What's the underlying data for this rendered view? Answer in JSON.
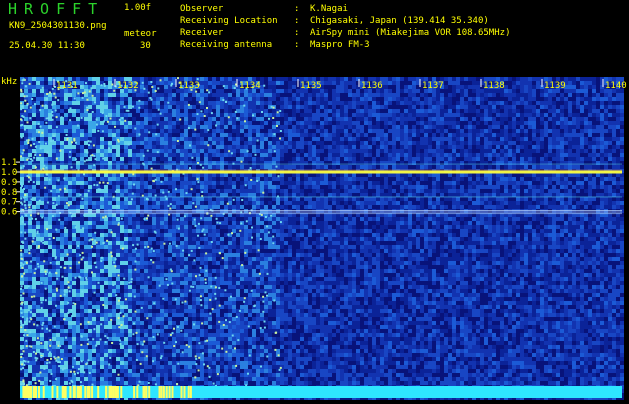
{
  "header": {
    "title": "HROFFT",
    "version": "1.00f",
    "file_name": "KN9_2504301130.png",
    "meteor_label": "meteor",
    "datetime": "25.04.30 11:30",
    "meteor_count": "30",
    "info": [
      {
        "key": "Observer",
        "value": "K.Nagai"
      },
      {
        "key": "Receiving Location",
        "value": "Chigasaki, Japan (139.414 35.340)"
      },
      {
        "key": "Receiver",
        "value": "AirSpy mini (Miakejima VOR 108.65MHz)"
      },
      {
        "key": "Receiving antenna",
        "value": "Maspro FM-3"
      }
    ]
  },
  "spectrogram": {
    "y_unit": "kHz",
    "y_ticks": [
      "1.1",
      "1.0",
      "0.9",
      "0.8",
      "0.7",
      "0.6"
    ],
    "x_ticks": [
      "1131",
      "1132",
      "1133",
      "1134",
      "1135",
      "1136",
      "1137",
      "1138",
      "1139",
      "1140"
    ],
    "colors": {
      "background": "#000000",
      "noise_base": "#0a1c8c",
      "carrier": "#ffff40",
      "axis_text": "#ffff00",
      "title": "#2bd32b",
      "bottom_band": "#2ee6ff"
    }
  }
}
